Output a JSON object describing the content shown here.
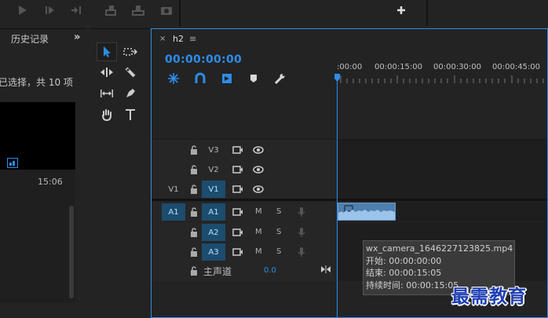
{
  "history_panel": {
    "title": "历史记录",
    "more_icon": "»",
    "status": "已选择，共 10 项",
    "media_duration": "15:06"
  },
  "timeline": {
    "sequence_name": "h2",
    "close_glyph": "×",
    "menu_glyph": "≡",
    "timecode": "00:00:00:00",
    "ruler": [
      ":00:00",
      "00:00:15:00",
      "00:00:30:00",
      "00:00:45:00"
    ]
  },
  "tracks": {
    "video": [
      {
        "name": "V3",
        "source": ""
      },
      {
        "name": "V2",
        "source": ""
      },
      {
        "name": "V1",
        "source": "V1"
      }
    ],
    "audio": [
      {
        "name": "A1",
        "source": "A1",
        "mute": "M",
        "solo": "S"
      },
      {
        "name": "A2",
        "source": "",
        "mute": "M",
        "solo": "S"
      },
      {
        "name": "A3",
        "source": "",
        "mute": "M",
        "solo": "S"
      }
    ],
    "master": {
      "label": "主声道",
      "value": "0.0"
    }
  },
  "clip_tooltip": {
    "filename": "wx_camera_1646227123825.mp4",
    "start": "开始: 00:00:00:00",
    "end": "结束: 00:00:15:05",
    "duration": "持续时间: 00:00:15:05"
  },
  "watermark": "最需教育",
  "colors": {
    "accent": "#2d8ceb",
    "track_target": "#1c4d6e",
    "clip": "#4e7fae",
    "watermark": "#1f3fb3"
  },
  "icons": [
    "play-icon",
    "step-forward-icon",
    "shuttle-icon",
    "lift-icon",
    "extract-icon",
    "camera-icon",
    "add-icon",
    "selection-tool-icon",
    "track-select-icon",
    "ripple-edit-icon",
    "razor-icon",
    "slip-icon",
    "pen-icon",
    "hand-icon",
    "type-icon",
    "snap-icon",
    "magnet-icon",
    "linked-icon",
    "marker-icon",
    "wrench-icon",
    "lock-icon",
    "film-icon",
    "eye-icon",
    "mic-icon"
  ]
}
